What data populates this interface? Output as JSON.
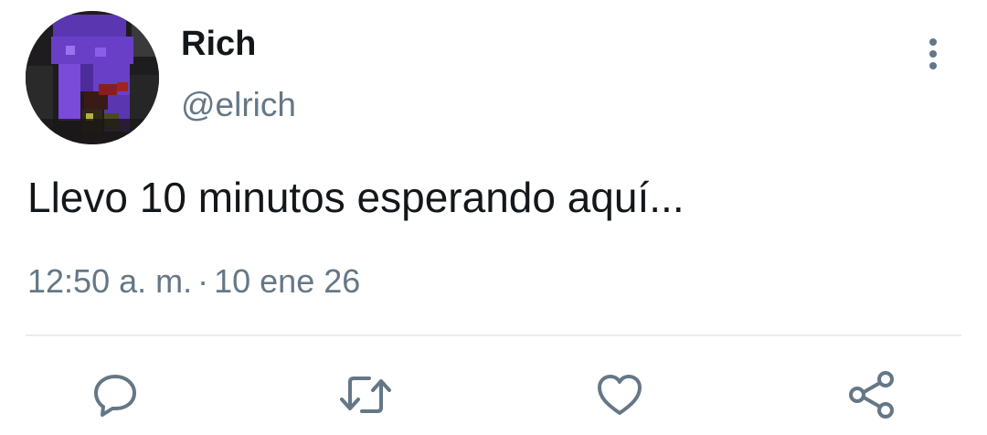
{
  "tweet": {
    "author": {
      "display_name": "Rich",
      "handle": "@elrich"
    },
    "text": "Llevo 10 minutos esperando aquí...",
    "time": "12:50 a. m.",
    "separator": "·",
    "date": "10 ene 26"
  },
  "icons": {
    "more": "more-vertical-icon",
    "reply": "reply-icon",
    "retweet": "retweet-icon",
    "like": "heart-icon",
    "share": "share-icon"
  },
  "colors": {
    "text_primary": "#14171a",
    "text_secondary": "#657786",
    "divider": "#e6ecf0",
    "avatar_purple": "#6a3fc8"
  }
}
